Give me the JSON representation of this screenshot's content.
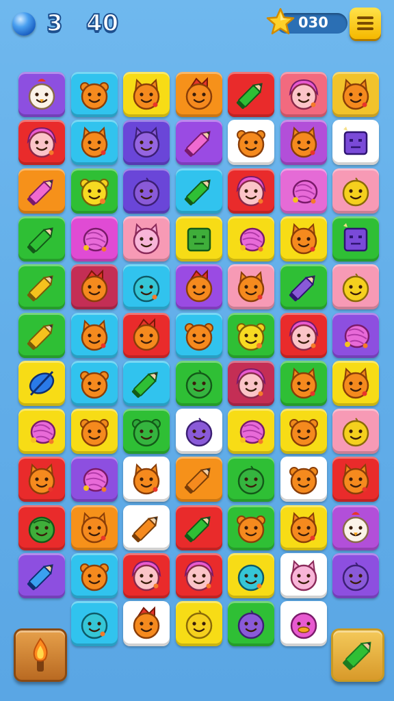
{
  "hud": {
    "lives": "3",
    "moves": "40",
    "stars": "030"
  },
  "board": {
    "rows": [
      [
        {
          "bg": "#8d4fe0",
          "icon": "chicken"
        },
        {
          "bg": "#31c3ee",
          "icon": "bear"
        },
        {
          "bg": "#f7dc16",
          "icon": "cat"
        },
        {
          "bg": "#f6911a",
          "icon": "monkey"
        },
        {
          "bg": "#e92b2b",
          "icon": "pencil-green"
        },
        {
          "bg": "#f26a7f",
          "icon": "pink-girl"
        },
        {
          "bg": "#f2c32b",
          "icon": "cat"
        }
      ],
      [
        {
          "bg": "#e92b2b",
          "icon": "pink-girl"
        },
        {
          "bg": "#31c3ee",
          "icon": "cat"
        },
        {
          "bg": "#6a46d8",
          "icon": "purple-cat"
        },
        {
          "bg": "#9a4be3",
          "icon": "pencil-pink"
        },
        {
          "bg": "#ffffff",
          "icon": "bear"
        },
        {
          "bg": "#b24fd9",
          "icon": "cat"
        },
        {
          "bg": "#ffffff",
          "icon": "robot-purple"
        }
      ],
      [
        {
          "bg": "#f6911a",
          "icon": "pencil-pink"
        },
        {
          "bg": "#2fbf35",
          "icon": "bear-yellow"
        },
        {
          "bg": "#6a46d8",
          "icon": "purple-blob"
        },
        {
          "bg": "#31c3ee",
          "icon": "pencil-green"
        },
        {
          "bg": "#e92b2b",
          "icon": "pink-girl"
        },
        {
          "bg": "#e56bd6",
          "icon": "shell"
        },
        {
          "bg": "#f79ab5",
          "icon": "yellow-blob"
        }
      ],
      [
        {
          "bg": "#2fbf35",
          "icon": "pencil-green"
        },
        {
          "bg": "#e04bd4",
          "icon": "shell"
        },
        {
          "bg": "#f79ab5",
          "icon": "pink-cat"
        },
        {
          "bg": "#f7dc16",
          "icon": "robot-green"
        },
        {
          "bg": "#f7dc16",
          "icon": "shell"
        },
        {
          "bg": "#f7dc16",
          "icon": "cat"
        },
        {
          "bg": "#2fbf35",
          "icon": "robot-purple"
        }
      ],
      [
        {
          "bg": "#2fbf35",
          "icon": "pencil-yellow"
        },
        {
          "bg": "#c42e55",
          "icon": "monkey"
        },
        {
          "bg": "#31c3ee",
          "icon": "teal-blob"
        },
        {
          "bg": "#9a4be3",
          "icon": "monkey"
        },
        {
          "bg": "#f79ab5",
          "icon": "cat"
        },
        {
          "bg": "#2fbf35",
          "icon": "pencil-purple"
        },
        {
          "bg": "#f79ab5",
          "icon": "yellow-blob"
        }
      ],
      [
        {
          "bg": "#2fbf35",
          "icon": "pencil-yellow"
        },
        {
          "bg": "#31c3ee",
          "icon": "cat"
        },
        {
          "bg": "#e92b2b",
          "icon": "monkey"
        },
        {
          "bg": "#31c3ee",
          "icon": "bear"
        },
        {
          "bg": "#2fbf35",
          "icon": "bear-yellow"
        },
        {
          "bg": "#e92b2b",
          "icon": "pink-girl"
        },
        {
          "bg": "#8d4fe0",
          "icon": "shell"
        }
      ],
      [
        {
          "bg": "#f7dc16",
          "icon": "spinner"
        },
        {
          "bg": "#31c3ee",
          "icon": "bear"
        },
        {
          "bg": "#31c3ee",
          "icon": "pencil-green"
        },
        {
          "bg": "#2fbf35",
          "icon": "green-blob"
        },
        {
          "bg": "#c42e55",
          "icon": "pink-girl"
        },
        {
          "bg": "#2fbf35",
          "icon": "cat"
        },
        {
          "bg": "#f7dc16",
          "icon": "cat"
        }
      ],
      [
        {
          "bg": "#f7dc16",
          "icon": "shell"
        },
        {
          "bg": "#f7dc16",
          "icon": "bear"
        },
        {
          "bg": "#2fbf35",
          "icon": "green-bear"
        },
        {
          "bg": "#ffffff",
          "icon": "purple-blob"
        },
        {
          "bg": "#f7dc16",
          "icon": "shell"
        },
        {
          "bg": "#f7dc16",
          "icon": "bear"
        },
        {
          "bg": "#f79ab5",
          "icon": "yellow-blob"
        }
      ],
      [
        {
          "bg": "#e92b2b",
          "icon": "cat"
        },
        {
          "bg": "#8d4fe0",
          "icon": "shell"
        },
        {
          "bg": "#ffffff",
          "icon": "cat"
        },
        {
          "bg": "#f6911a",
          "icon": "pencil-orange"
        },
        {
          "bg": "#2fbf35",
          "icon": "green-blob"
        },
        {
          "bg": "#ffffff",
          "icon": "bear"
        },
        {
          "bg": "#e92b2b",
          "icon": "cat"
        }
      ],
      [
        {
          "bg": "#e92b2b",
          "icon": "turtle"
        },
        {
          "bg": "#f6911a",
          "icon": "cat"
        },
        {
          "bg": "#ffffff",
          "icon": "pencil-orange"
        },
        {
          "bg": "#e92b2b",
          "icon": "pencil-green"
        },
        {
          "bg": "#2fbf35",
          "icon": "bear"
        },
        {
          "bg": "#f7dc16",
          "icon": "cat"
        },
        {
          "bg": "#b24fd9",
          "icon": "chicken"
        }
      ],
      [
        {
          "bg": "#8d4fe0",
          "icon": "pencil-blue"
        },
        {
          "bg": "#31c3ee",
          "icon": "bear"
        },
        {
          "bg": "#e92b2b",
          "icon": "pink-girl"
        },
        {
          "bg": "#e92b2b",
          "icon": "pink-girl"
        },
        {
          "bg": "#f7dc16",
          "icon": "teal-blob"
        },
        {
          "bg": "#ffffff",
          "icon": "pink-cat"
        },
        {
          "bg": "#8d4fe0",
          "icon": "purple-blob"
        }
      ],
      [
        null,
        {
          "bg": "#31c3ee",
          "icon": "teal-blob"
        },
        {
          "bg": "#ffffff",
          "icon": "monkey"
        },
        {
          "bg": "#f7dc16",
          "icon": "yellow-blob"
        },
        {
          "bg": "#2fbf35",
          "icon": "purple-blob"
        },
        {
          "bg": "#ffffff",
          "icon": "duck"
        },
        null
      ]
    ]
  },
  "boosters": {
    "left": {
      "icon": "torch-icon"
    },
    "right": {
      "icon": "green-pencil-icon"
    }
  }
}
